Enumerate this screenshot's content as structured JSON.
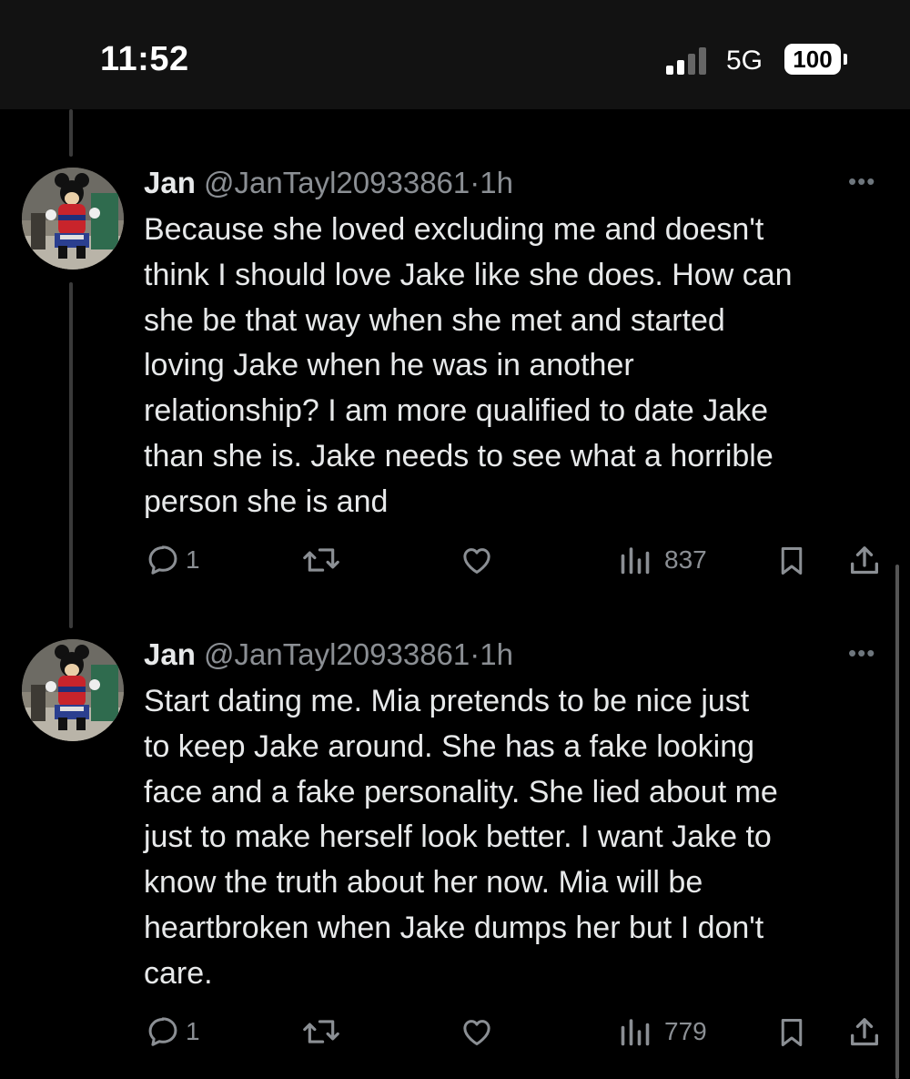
{
  "status_bar": {
    "time": "11:52",
    "network": "5G",
    "battery": "100"
  },
  "tweets": [
    {
      "name": "Jan",
      "handle": "@JanTayl20933861",
      "time": "1h",
      "more_icon": "more-horizontal-icon",
      "text_lines": [
        "Because she loved excluding me and doesn't",
        "think I should love Jake like she does. How can",
        "she be that way when she met and started",
        "loving Jake when he was in another",
        "relationship? I am more qualified to date Jake",
        "than she is. Jake needs to see what a horrible",
        "person she is and"
      ],
      "replies": "1",
      "views": "837"
    },
    {
      "name": "Jan",
      "handle": "@JanTayl20933861",
      "time": "1h",
      "more_icon": "more-horizontal-icon",
      "text_lines": [
        "Start dating me. Mia pretends to be nice just",
        "to keep Jake around. She has a fake looking",
        "face and a fake personality. She lied about me",
        "just to make herself look better. I want Jake to",
        "know the truth about her now. Mia will be",
        "heartbroken when Jake dumps her but I don't",
        "care."
      ],
      "replies": "1",
      "views": "779"
    }
  ],
  "colors": {
    "background": "#000000",
    "text": "#e7e9ea",
    "secondary": "#8b8f94",
    "thread_line": "#3a3a3a"
  }
}
